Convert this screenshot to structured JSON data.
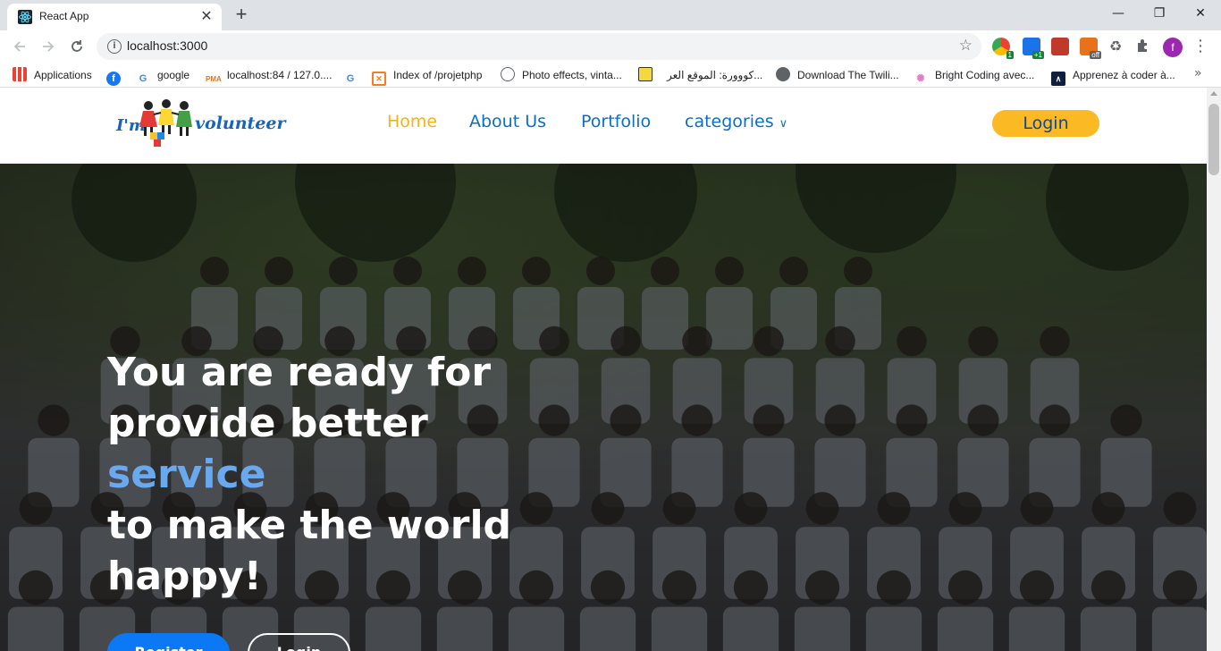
{
  "browser": {
    "tab": {
      "title": "React App",
      "close_glyph": "✕"
    },
    "new_tab_glyph": "+",
    "window_controls": {
      "minimize": "—",
      "restore": "❐",
      "close": "✕"
    },
    "url": "localhost:3000",
    "profile_initial": "f",
    "extensions": [
      {
        "icon": "chrome-ext-icon",
        "badge": "1"
      },
      {
        "icon": "window-ext-icon",
        "badge": "+1"
      },
      {
        "icon": "photo-ext-icon",
        "badge": ""
      },
      {
        "icon": "off-ext-icon",
        "badge": "off"
      },
      {
        "icon": "recycle-icon",
        "badge": ""
      },
      {
        "icon": "puzzle-icon",
        "badge": ""
      }
    ],
    "bookmarks": [
      {
        "label": "Applications",
        "icon": "apps-grid-icon"
      },
      {
        "label": "",
        "icon": "facebook-icon"
      },
      {
        "label": "google",
        "icon": "google-icon"
      },
      {
        "label": "localhost:84 / 127.0....",
        "icon": "pma-icon"
      },
      {
        "label": "",
        "icon": "google-icon"
      },
      {
        "label": "Index of /projetphp",
        "icon": "xampp-icon"
      },
      {
        "label": "Photo effects, vinta...",
        "icon": "photo-effects-icon"
      },
      {
        "label": "",
        "icon": "bookmark-yellow-icon"
      },
      {
        "label": "كووورة: الموقع العر...",
        "icon": "kooora-icon"
      },
      {
        "label": "Download The Twili...",
        "icon": "globe-icon"
      },
      {
        "label": "Bright Coding avec...",
        "icon": "bright-coding-icon"
      },
      {
        "label": "Apprenez à coder à...",
        "icon": "apprenez-icon"
      }
    ],
    "bookmarks_overflow": "»"
  },
  "site": {
    "logo": {
      "im": "I'm",
      "word": "volunteer"
    },
    "nav": {
      "home": "Home",
      "about": "About Us",
      "portfolio": "Portfolio",
      "categories": "categories",
      "caret": "⌄",
      "login": "Login"
    },
    "hero": {
      "line1": "You are ready for",
      "line2": "provide better",
      "line3": "service",
      "line4": "to make the world",
      "line5": "happy!",
      "register_button": "Register",
      "login_button": "Login"
    },
    "colors": {
      "nav_link": "#0d6ec8",
      "nav_active": "#f6b21b",
      "login_bg": "#fbb923",
      "accent_word": "#6aa9ee",
      "register_bg": "#0b79f5"
    }
  }
}
